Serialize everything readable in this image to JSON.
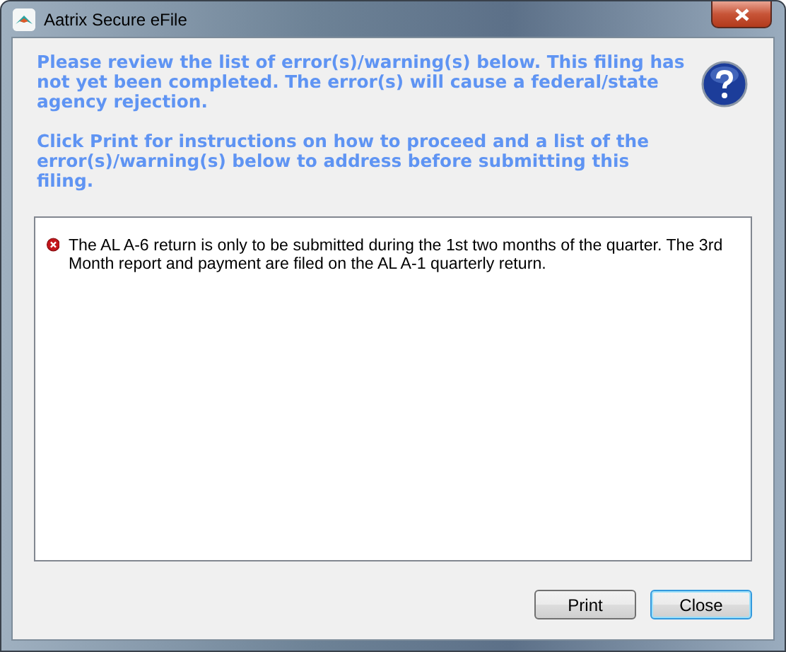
{
  "window": {
    "title": "Aatrix Secure eFile"
  },
  "instructions": [
    "Please review the list of error(s)/warning(s) below. This filing has not yet been completed. The error(s) will cause a federal/state agency rejection.",
    "Click Print for instructions on how to proceed and a list of the error(s)/warning(s) below to address before submitting this filing."
  ],
  "messages": [
    {
      "kind": "error",
      "text": "The AL A-6 return is only to be submitted during the 1st two months of the quarter. The 3rd Month report and payment are filed on the AL A-1 quarterly return."
    }
  ],
  "buttons": [
    {
      "label": "Print",
      "default": false
    },
    {
      "label": "Close",
      "default": true
    }
  ]
}
